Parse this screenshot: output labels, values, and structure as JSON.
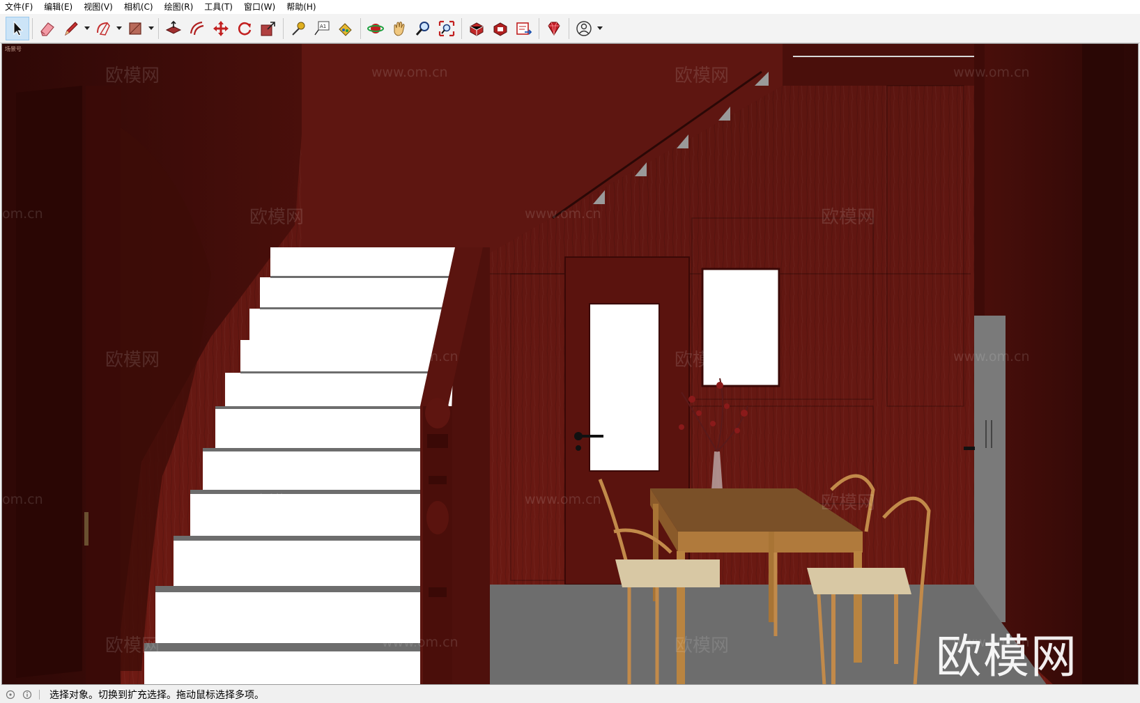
{
  "menu": [
    {
      "label": "文件(F)"
    },
    {
      "label": "编辑(E)"
    },
    {
      "label": "视图(V)"
    },
    {
      "label": "相机(C)"
    },
    {
      "label": "绘图(R)"
    },
    {
      "label": "工具(T)"
    },
    {
      "label": "窗口(W)"
    },
    {
      "label": "帮助(H)"
    }
  ],
  "toolbar": {
    "tools": [
      "select-tool",
      "eraser-tool",
      "line-tool",
      "arc-tool",
      "rectangle-tool",
      "push-pull-tool",
      "offset-tool",
      "move-tool",
      "rotate-tool",
      "scale-tool",
      "tape-measure-tool",
      "text-tool",
      "paint-bucket-tool",
      "orbit-tool",
      "pan-tool",
      "zoom-tool",
      "zoom-extents-tool",
      "warehouse-tool",
      "extension-warehouse-tool",
      "send-to-layout-tool",
      "extension-manager-tool",
      "account-tool"
    ],
    "active_tool": "select-tool"
  },
  "viewport": {
    "corner_tag": "场景号",
    "watermark_brand": "欧模网",
    "watermark_url": "www.om.cn",
    "watermark_partial": "om.cn",
    "big_brand": "欧模网"
  },
  "colors": {
    "wood_wall": "#6a1813",
    "wood_dark": "#3d0b08",
    "stair_white": "#ffffff",
    "floor": "#6d6d6d",
    "table": "#b07a3c",
    "chair": "#c28a4a",
    "toolbar_active": "#cce4f7"
  },
  "status": {
    "text": "选择对象。切换到扩充选择。拖动鼠标选择多项。"
  }
}
